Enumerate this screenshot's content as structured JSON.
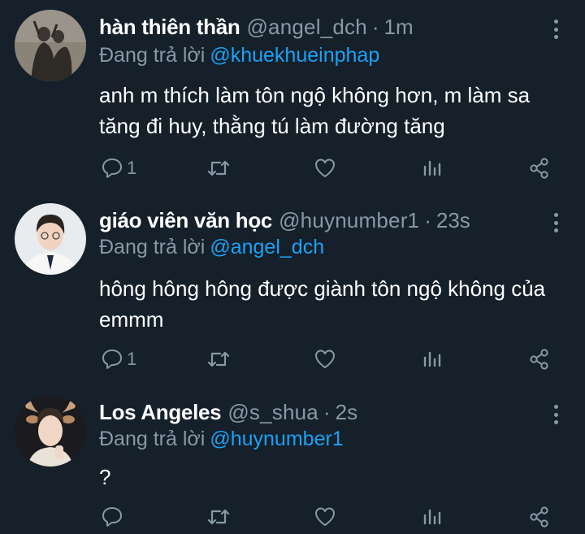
{
  "tweets": [
    {
      "name": "hàn thiên thần",
      "handle": "@angel_dch",
      "separator": "·",
      "time": "1m",
      "reply_prefix": "Đang trả lời",
      "reply_to": "@khuekhueinphap",
      "text": "anh m thích làm tôn ngộ không hơn, m làm sa tăng đi huy, thằng tú làm đường tăng",
      "reply_count": "1",
      "retweet_count": "",
      "like_count": ""
    },
    {
      "name": "giáo viên văn học",
      "handle": "@huynumber1",
      "separator": "·",
      "time": "23s",
      "reply_prefix": "Đang trả lời",
      "reply_to": "@angel_dch",
      "text": "hông hông hông được giành tôn ngộ không của emmm",
      "reply_count": "1",
      "retweet_count": "",
      "like_count": ""
    },
    {
      "name": "Los Angeles",
      "handle": "@s_shua",
      "separator": "·",
      "time": "2s",
      "reply_prefix": "Đang trả lời",
      "reply_to": "@huynumber1",
      "text": "?",
      "reply_count": "",
      "retweet_count": "",
      "like_count": ""
    }
  ],
  "icons": {
    "reply": "reply-icon",
    "retweet": "retweet-icon",
    "like": "heart-icon",
    "analytics": "analytics-icon",
    "share": "share-icon",
    "more": "more-vertical-icon"
  },
  "colors": {
    "background": "#15202b",
    "secondary_text": "#8899a6",
    "link": "#1da1f2",
    "primary_text": "#ffffff"
  }
}
